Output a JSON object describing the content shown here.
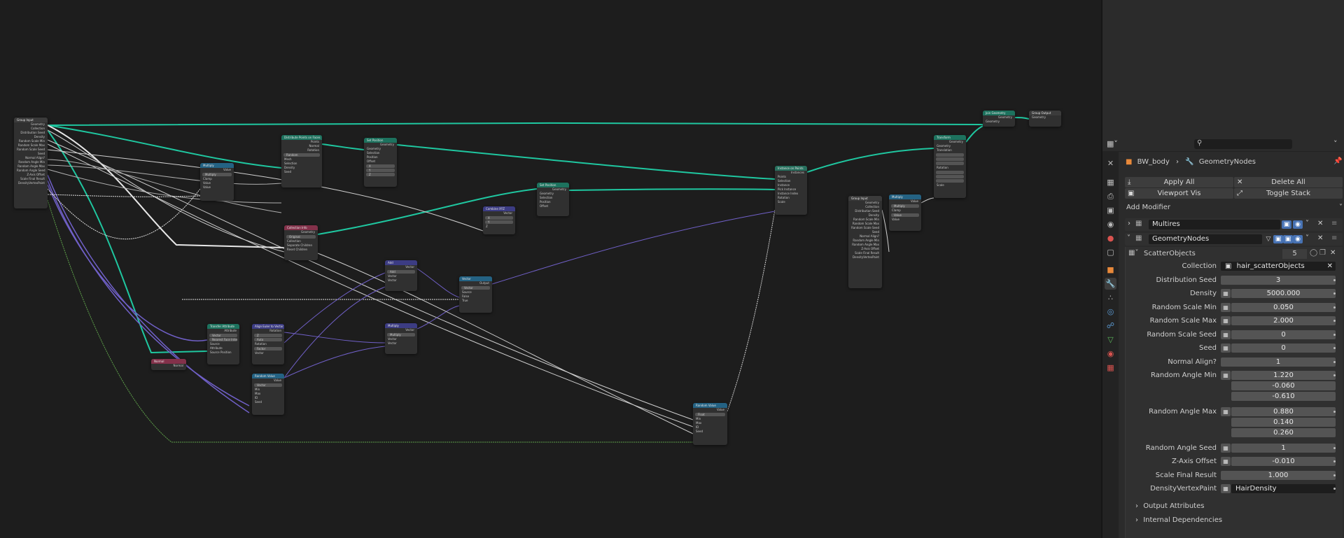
{
  "properties": {
    "breadcrumb": {
      "object": "BW_body",
      "modifier": "GeometryNodes"
    },
    "buttons": {
      "apply_all": "Apply All",
      "delete_all": "Delete All",
      "viewport_vis": "Viewport Vis",
      "toggle_stack": "Toggle Stack",
      "add_modifier": "Add Modifier"
    },
    "modifiers": [
      {
        "name": "Multires"
      },
      {
        "name": "GeometryNodes",
        "node_group": "ScatterObjects",
        "users": "5"
      }
    ],
    "inputs": [
      {
        "label": "Collection",
        "value": "hair_scatterObjects"
      },
      {
        "label": "Distribution Seed",
        "value": "3"
      },
      {
        "label": "Density",
        "value": "5000.000"
      },
      {
        "label": "Random Scale Min",
        "value": "0.050"
      },
      {
        "label": "Random Scale Max",
        "value": "2.000"
      },
      {
        "label": "Random Scale Seed",
        "value": "0"
      },
      {
        "label": "Seed",
        "value": "0"
      },
      {
        "label": "Normal Align?",
        "value": "1"
      },
      {
        "label": "Random Angle Min",
        "values": [
          "1.220",
          "-0.060",
          "-0.610"
        ]
      },
      {
        "label": "Random Angle Max",
        "values": [
          "0.880",
          "0.140",
          "0.260"
        ]
      },
      {
        "label": "Random Angle Seed",
        "value": "1"
      },
      {
        "label": "Z-Axis Offset",
        "value": "-0.010"
      },
      {
        "label": "Scale Final Result",
        "value": "1.000"
      },
      {
        "label": "DensityVertexPaint",
        "value": "HairDensity"
      }
    ],
    "sections": {
      "output_attributes": "Output Attributes",
      "internal_dependencies": "Internal Dependencies"
    }
  },
  "nodes": {
    "group_input": {
      "title": "Group Input",
      "sockets": [
        "Geometry",
        "Collection",
        "Distribution Seed",
        "Density",
        "Random Scale Min",
        "Random Scale Max",
        "Random Scale Seed",
        "Seed",
        "Normal Align?",
        "Random Angle Min",
        "Random Angle Max",
        "Random Angle Seed",
        "Z-Axis Offset",
        "Scale Final Result",
        "DensityVertexPaint"
      ]
    },
    "distribute": {
      "title": "Distribute Points on Faces",
      "rows": [
        "Points",
        "Normal",
        "Rotation",
        "Random",
        "Mesh",
        "Selection",
        "Distance Min",
        "Density",
        "Seed"
      ]
    },
    "set_position_1": {
      "title": "Set Position",
      "rows": [
        "Geometry",
        "Geometry",
        "Selection",
        "Position",
        "Offset",
        "X",
        "Y",
        "Z"
      ]
    },
    "multiply_1": {
      "title": "Multiply",
      "rows": [
        "Value",
        "Multiply",
        "Clamp",
        "Value",
        "Value"
      ]
    },
    "collection_info": {
      "title": "Collection Info",
      "rows": [
        "Geometry",
        "Original",
        "Relative",
        "Collection",
        "Separate Children",
        "Reset Children"
      ]
    },
    "combine_xyz": {
      "title": "Combine XYZ",
      "rows": [
        "Vector",
        "X",
        "Y",
        "Z"
      ]
    },
    "set_position_2": {
      "title": "Set Position",
      "rows": [
        "Geometry",
        "Geometry",
        "Selection",
        "Position",
        "Offset"
      ]
    },
    "instance_on_points": {
      "title": "Instance on Points",
      "rows": [
        "Instances",
        "Points",
        "Selection",
        "Instance",
        "Pick Instance",
        "Instance Index",
        "Rotation",
        "Scale"
      ]
    },
    "transform": {
      "title": "Transform",
      "rows": [
        "Geometry",
        "Geometry",
        "Translation",
        "Rotation",
        "Scale"
      ]
    },
    "join_geometry": {
      "title": "Join Geometry",
      "rows": [
        "Geometry",
        "Geometry"
      ]
    },
    "group_output": {
      "title": "Group Output",
      "rows": [
        "Geometry"
      ]
    },
    "group_input_2": {
      "title": "Group Input",
      "rows": [
        "Geometry",
        "Collection",
        "Distribution Seed",
        "Density",
        "Random Scale Min",
        "Random Scale Max",
        "Random Scale Seed",
        "Seed",
        "Normal Align?",
        "Random Angle Min",
        "Random Angle Max",
        "Z-Axis Offset",
        "Scale Final Result",
        "DensityVertexPaint"
      ]
    },
    "multiply_2": {
      "title": "Multiply",
      "rows": [
        "Value",
        "Multiply",
        "Clamp",
        "Value",
        "Value"
      ]
    },
    "add": {
      "title": "Add",
      "rows": [
        "Vector",
        "Add",
        "Vector",
        "Vector"
      ]
    },
    "vector": {
      "title": "Vector",
      "rows": [
        "Output",
        "Vector",
        "Source",
        "False",
        "True"
      ]
    },
    "multiply_3": {
      "title": "Multiply",
      "rows": [
        "Vector",
        "Multiply",
        "Vector",
        "Vector"
      ]
    },
    "transfer_attribute": {
      "title": "Transfer Attribute",
      "rows": [
        "Attribute",
        "Vector",
        "Nearest Face Interp.",
        "Source",
        "Attribute",
        "Source Position"
      ]
    },
    "align_euler": {
      "title": "Align Euler to Vector",
      "rows": [
        "Rotation",
        "X",
        "Y",
        "Z",
        "Pivot",
        "Auto",
        "Rotation",
        "Factor",
        "Vector"
      ]
    },
    "normal": {
      "title": "Normal",
      "rows": [
        "Normal"
      ]
    },
    "random_value_1": {
      "title": "Random Value",
      "rows": [
        "Value",
        "Vector",
        "Min",
        "Max",
        "ID",
        "Seed"
      ]
    },
    "random_value_2": {
      "title": "Random Value",
      "rows": [
        "Value",
        "Float",
        "Min",
        "Max",
        "ID",
        "Seed"
      ]
    }
  }
}
